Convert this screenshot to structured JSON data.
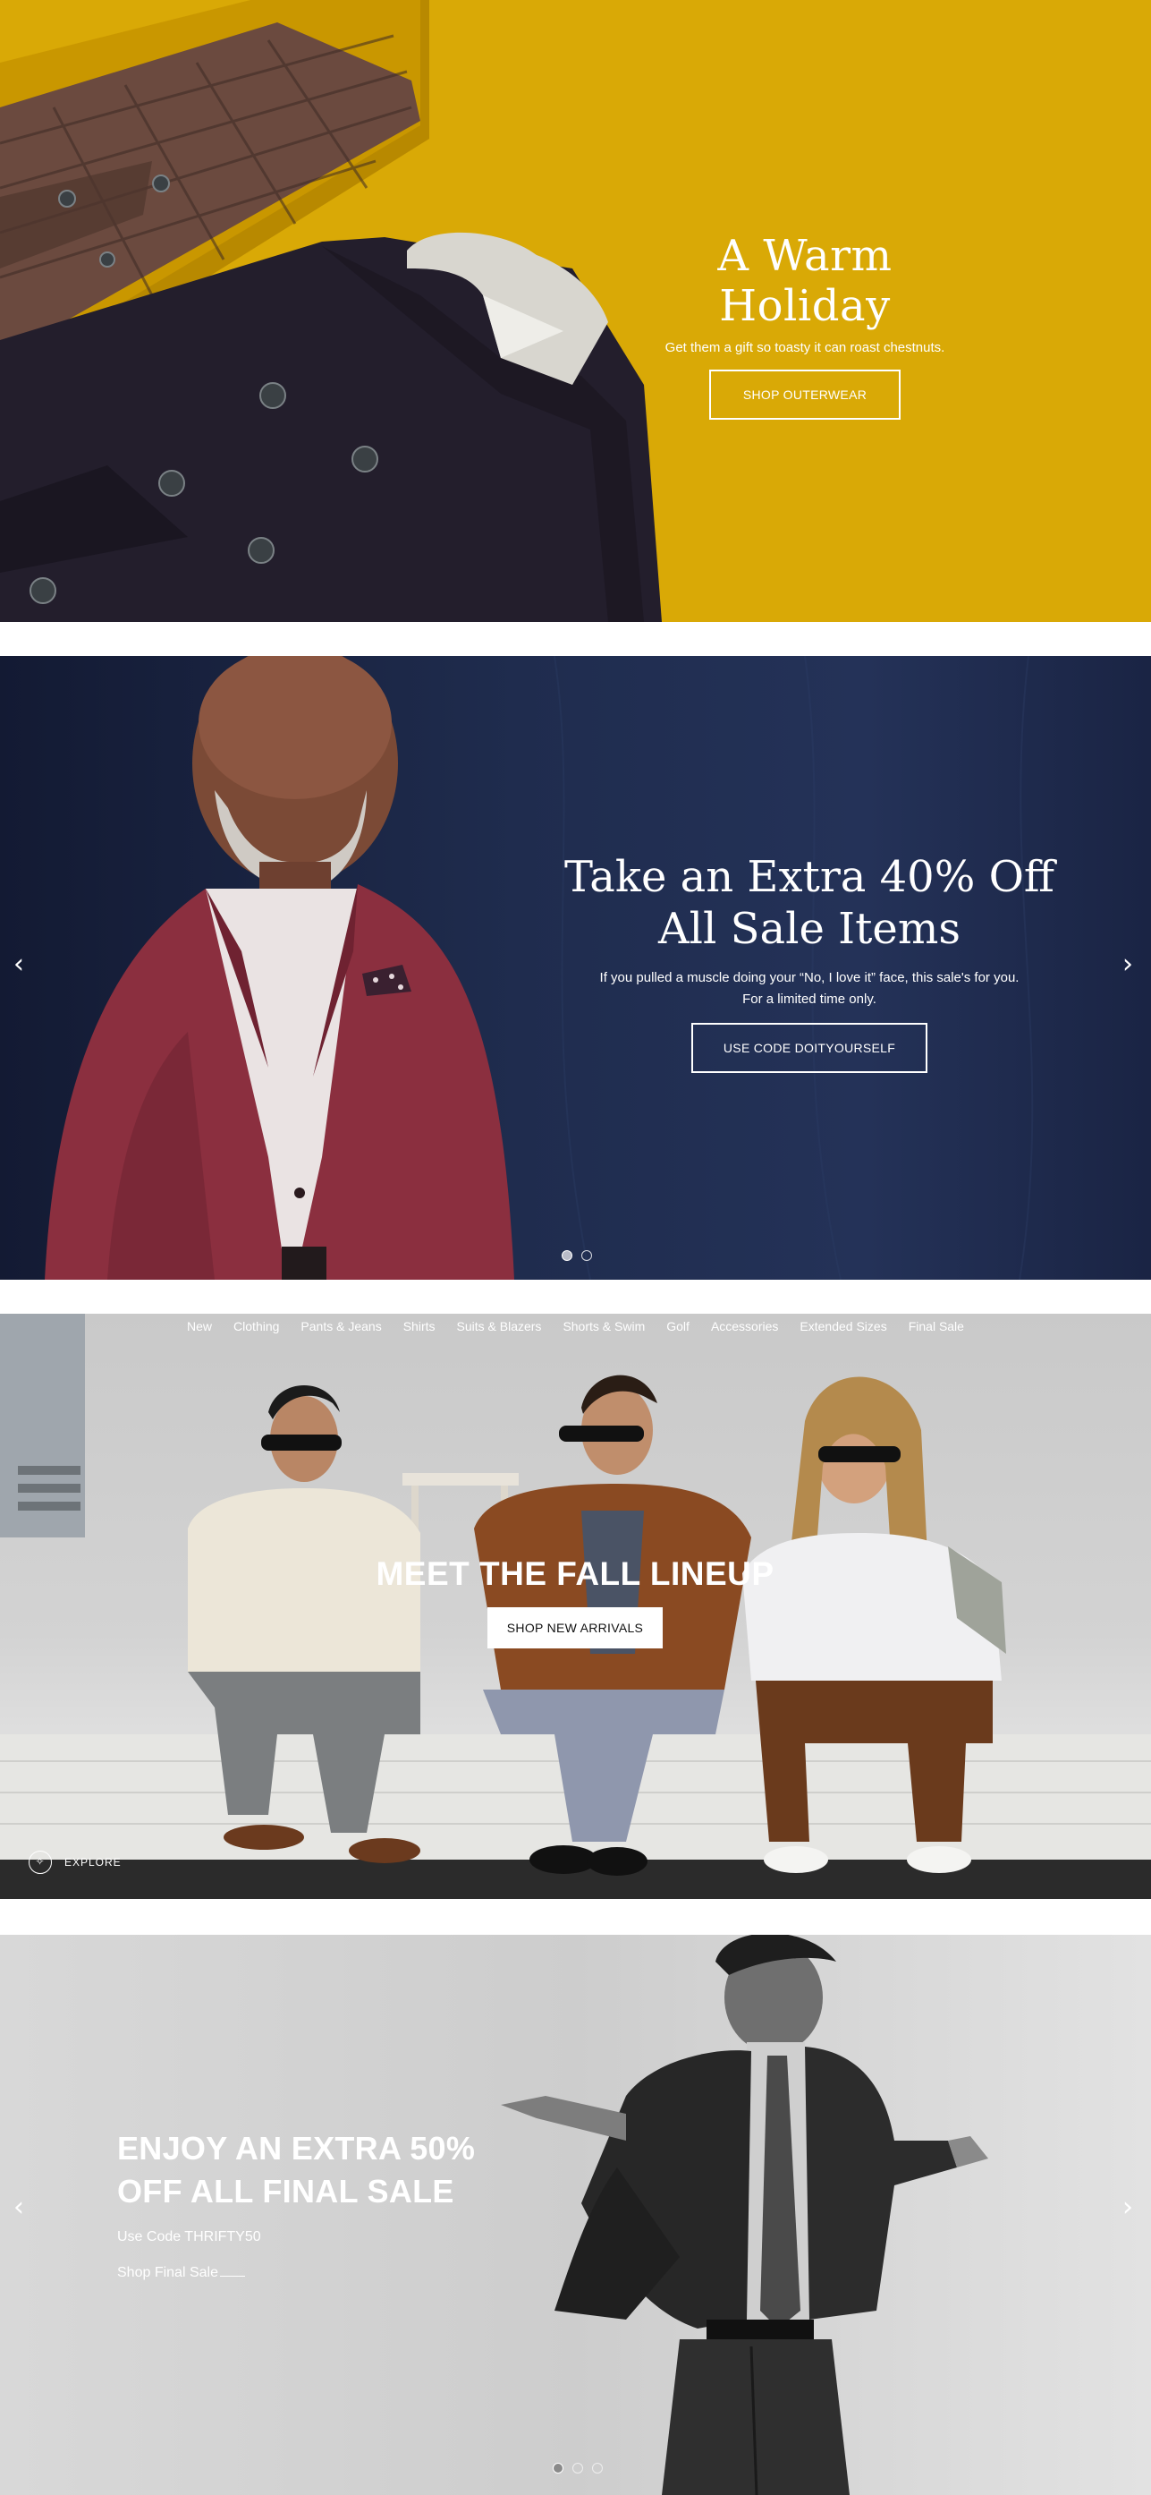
{
  "banner_outerwear": {
    "title": "A Warm Holiday",
    "subtitle": "Get them a gift so toasty it can roast chestnuts.",
    "cta": "SHOP OUTERWEAR",
    "background_color": "#d9a906"
  },
  "banner_sale": {
    "title_line1": "Take an Extra 40% Off",
    "title_line2": "All Sale Items",
    "body_line1": "If you pulled a muscle doing your “No, I love it” face, this sale's for you.",
    "body_line2": "For a limited time only.",
    "cta": "USE CODE DOITYOURSELF",
    "prev_icon": "chevron-left-icon",
    "next_icon": "chevron-right-icon",
    "carousel_count": 2,
    "carousel_active": 1
  },
  "banner_fall": {
    "nav": [
      "New",
      "Clothing",
      "Pants & Jeans",
      "Shirts",
      "Suits & Blazers",
      "Shorts & Swim",
      "Golf",
      "Accessories",
      "Extended Sizes",
      "Final Sale"
    ],
    "title": "MEET THE FALL LINEUP",
    "cta": "SHOP NEW ARRIVALS",
    "explore_label": "EXPLORE"
  },
  "banner_final_sale": {
    "title_line1": "ENJOY AN EXTRA 50%",
    "title_line2": "OFF ALL FINAL SALE",
    "code_text": "Use Code THRIFTY50",
    "link_text": "Shop Final Sale",
    "carousel_count": 3,
    "carousel_active": 1
  }
}
